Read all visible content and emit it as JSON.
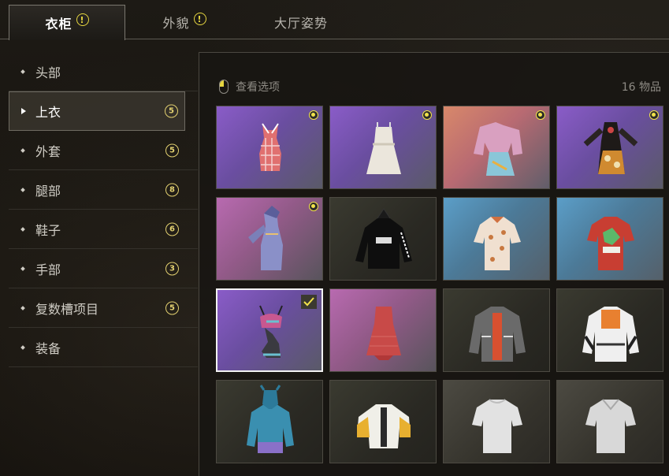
{
  "tabs": [
    {
      "label": "衣柜",
      "warn": "!"
    },
    {
      "label": "外貌",
      "warn": "!"
    },
    {
      "label": "大厅姿势",
      "warn": ""
    }
  ],
  "sidebar": {
    "items": [
      {
        "label": "头部",
        "count": ""
      },
      {
        "label": "上衣",
        "count": "5"
      },
      {
        "label": "外套",
        "count": "5"
      },
      {
        "label": "腿部",
        "count": "8"
      },
      {
        "label": "鞋子",
        "count": "6"
      },
      {
        "label": "手部",
        "count": "3"
      },
      {
        "label": "复数槽项目",
        "count": "5"
      },
      {
        "label": "装备",
        "count": ""
      }
    ]
  },
  "panel": {
    "view_options_label": "查看选项",
    "item_count": "16 物品"
  },
  "items": [
    {
      "name": "plaid-swimsuit",
      "bg": "purple",
      "badge": true,
      "selected": false
    },
    {
      "name": "white-dress",
      "bg": "purple",
      "badge": true,
      "selected": false
    },
    {
      "name": "pink-jacket-dress",
      "bg": "orange",
      "badge": true,
      "selected": false
    },
    {
      "name": "floral-dress",
      "bg": "purple",
      "badge": true,
      "selected": false
    },
    {
      "name": "blue-hooded-dress",
      "bg": "pink",
      "badge": true,
      "selected": false
    },
    {
      "name": "black-hoodie",
      "bg": "dark",
      "badge": false,
      "selected": false
    },
    {
      "name": "printed-shirt",
      "bg": "blue",
      "badge": false,
      "selected": false
    },
    {
      "name": "red-tshirt",
      "bg": "blue",
      "badge": false,
      "selected": false
    },
    {
      "name": "bikini-monokini",
      "bg": "purple",
      "badge": false,
      "selected": true
    },
    {
      "name": "red-mini-dress",
      "bg": "pink",
      "badge": false,
      "selected": false
    },
    {
      "name": "grey-orange-jacket",
      "bg": "dark",
      "badge": false,
      "selected": false
    },
    {
      "name": "white-orange-jacket",
      "bg": "dark",
      "badge": false,
      "selected": false
    },
    {
      "name": "teal-hoodie",
      "bg": "dark",
      "badge": false,
      "selected": false
    },
    {
      "name": "yellow-bomber",
      "bg": "dark",
      "badge": false,
      "selected": false
    },
    {
      "name": "white-tshirt",
      "bg": "grey",
      "badge": false,
      "selected": false
    },
    {
      "name": "white-tshirt-2",
      "bg": "grey",
      "badge": false,
      "selected": false
    }
  ]
}
